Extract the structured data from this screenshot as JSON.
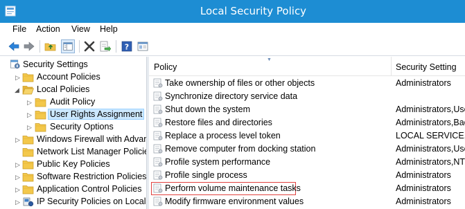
{
  "window": {
    "title": "Local Security Policy"
  },
  "menu": [
    "File",
    "Action",
    "View",
    "Help"
  ],
  "toolbar": {
    "buttons": [
      "back-icon",
      "forward-icon",
      "up-folder-icon",
      "show-hide-tree-icon",
      "delete-icon",
      "export-list-icon",
      "help-icon",
      "properties-icon"
    ]
  },
  "tree": {
    "items": [
      {
        "label": "Security Settings",
        "level": 0,
        "expander": "open"
      },
      {
        "label": "Account Policies",
        "level": 1,
        "expander": "closed"
      },
      {
        "label": "Local Policies",
        "level": 1,
        "expander": "open"
      },
      {
        "label": "Audit Policy",
        "level": 2,
        "expander": "closed"
      },
      {
        "label": "User Rights Assignment",
        "level": 2,
        "expander": "closed",
        "selected": true
      },
      {
        "label": "Security Options",
        "level": 2,
        "expander": "closed"
      },
      {
        "label": "Windows Firewall with Advan",
        "level": 1,
        "expander": "closed"
      },
      {
        "label": "Network List Manager Policies",
        "level": 1,
        "expander": "none"
      },
      {
        "label": "Public Key Policies",
        "level": 1,
        "expander": "closed"
      },
      {
        "label": "Software Restriction Policies",
        "level": 1,
        "expander": "closed"
      },
      {
        "label": "Application Control Policies",
        "level": 1,
        "expander": "closed"
      },
      {
        "label": "IP Security Policies on Local C",
        "level": 1,
        "expander": "closed"
      }
    ]
  },
  "list": {
    "columns": {
      "policy": "Policy",
      "setting": "Security Setting"
    },
    "rows": [
      {
        "policy": "Take ownership of files or other objects",
        "setting": "Administrators"
      },
      {
        "policy": "Synchronize directory service data",
        "setting": ""
      },
      {
        "policy": "Shut down the system",
        "setting": "Administrators,Use"
      },
      {
        "policy": "Restore files and directories",
        "setting": "Administrators,Bac"
      },
      {
        "policy": "Replace a process level token",
        "setting": "LOCAL SERVICE,NE"
      },
      {
        "policy": "Remove computer from docking station",
        "setting": "Administrators,Use"
      },
      {
        "policy": "Profile system performance",
        "setting": "Administrators,NT"
      },
      {
        "policy": "Profile single process",
        "setting": "Administrators"
      },
      {
        "policy": "Perform volume maintenance tasks",
        "setting": "Administrators",
        "focused": true
      },
      {
        "policy": "Modify firmware environment values",
        "setting": "Administrators"
      }
    ]
  },
  "colors": {
    "titlebar": "#1d8dd3",
    "selection": "#cce8ff",
    "focus_outline": "#e0403e"
  }
}
